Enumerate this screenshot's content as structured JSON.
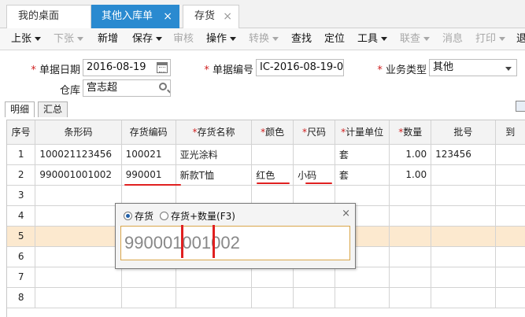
{
  "tabs": [
    {
      "label": "我的桌面",
      "active": false,
      "closable": false
    },
    {
      "label": "其他入库单",
      "active": true,
      "closable": true
    },
    {
      "label": "存货",
      "active": false,
      "closable": true
    }
  ],
  "toolbar": [
    {
      "label": "上张",
      "dropdown": true,
      "enabled": true
    },
    {
      "label": "下张",
      "dropdown": true,
      "enabled": false
    },
    {
      "label": "新增",
      "dropdown": false,
      "enabled": true
    },
    {
      "label": "保存",
      "dropdown": true,
      "enabled": true
    },
    {
      "label": "审核",
      "dropdown": false,
      "enabled": false
    },
    {
      "label": "操作",
      "dropdown": true,
      "enabled": true
    },
    {
      "label": "转换",
      "dropdown": true,
      "enabled": false
    },
    {
      "label": "查找",
      "dropdown": false,
      "enabled": true
    },
    {
      "label": "定位",
      "dropdown": false,
      "enabled": true
    },
    {
      "label": "工具",
      "dropdown": true,
      "enabled": true
    },
    {
      "label": "联查",
      "dropdown": true,
      "enabled": false
    },
    {
      "label": "消息",
      "dropdown": false,
      "enabled": false
    },
    {
      "label": "打印",
      "dropdown": true,
      "enabled": false
    },
    {
      "label": "退",
      "dropdown": false,
      "enabled": true
    }
  ],
  "form": {
    "date_label": "单据日期",
    "date_value": "2016-08-19",
    "code_label": "单据编号",
    "code_value": "IC-2016-08-19-0...",
    "biztype_label": "业务类型",
    "biztype_value": "其他",
    "warehouse_label": "仓库",
    "warehouse_value": "宫志超"
  },
  "subtabs": [
    {
      "label": "明细",
      "active": true
    },
    {
      "label": "汇总",
      "active": false
    }
  ],
  "grid": {
    "columns": [
      "序号",
      "条形码",
      "存货编码",
      "*存货名称",
      "*颜色",
      "*尺码",
      "*计量单位",
      "*数量",
      "批号",
      "到"
    ],
    "rows": [
      [
        "1",
        "100021123456",
        "100021",
        "亚光涂料",
        "",
        "",
        "套",
        "1.00",
        "123456",
        ""
      ],
      [
        "2",
        "990001001002",
        "990001",
        "新款T恤",
        "红色",
        "小码",
        "套",
        "1.00",
        "",
        ""
      ],
      [
        "3",
        "",
        "",
        "",
        "",
        "",
        "",
        "",
        "",
        ""
      ],
      [
        "4",
        "",
        "",
        "",
        "",
        "",
        "",
        "",
        "",
        ""
      ],
      [
        "5",
        "",
        "",
        "",
        "",
        "",
        "",
        "",
        "",
        ""
      ],
      [
        "6",
        "",
        "",
        "",
        "",
        "",
        "",
        "",
        "",
        ""
      ],
      [
        "7",
        "",
        "",
        "",
        "",
        "",
        "",
        "",
        "",
        ""
      ],
      [
        "8",
        "",
        "",
        "",
        "",
        "",
        "",
        "",
        "",
        ""
      ]
    ],
    "selected_row": 4
  },
  "popup": {
    "option1": "存货",
    "option2": "存货+数量(F3)",
    "selected": "option1",
    "input_value": "990001001002",
    "close": "×"
  },
  "colors": {
    "accent": "#2a8ad0",
    "annotation_red": "#e02020",
    "selected_row": "#fce9cf",
    "required": "#d02020"
  }
}
